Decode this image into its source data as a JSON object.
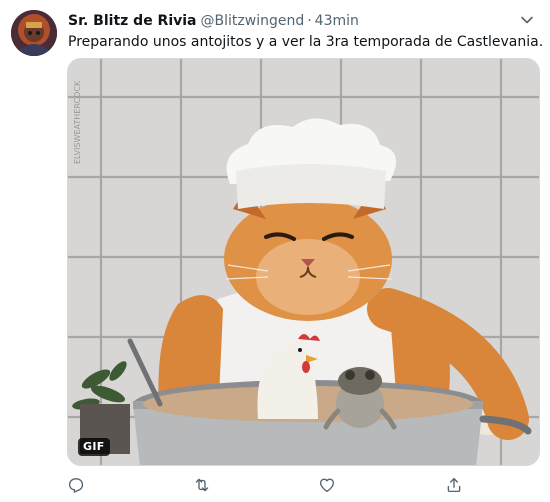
{
  "tweet": {
    "display_name": "Sr. Blitz de Rivia",
    "handle": "@Blitzwingend",
    "separator": "·",
    "time": "43min",
    "text": "Preparando unos antojitos y a ver la 3ra temporada de Castlevania.",
    "media": {
      "type": "gif",
      "badge": "GIF",
      "watermark": "ELVISWEATHERCOCK"
    }
  },
  "actions": {
    "reply_icon": "reply-icon",
    "retweet_icon": "retweet-icon",
    "like_icon": "heart-icon",
    "share_icon": "share-icon"
  },
  "colors": {
    "text_primary": "#0f1419",
    "text_secondary": "#536471",
    "icon_gray": "#536471",
    "border": "#cfd9de"
  }
}
